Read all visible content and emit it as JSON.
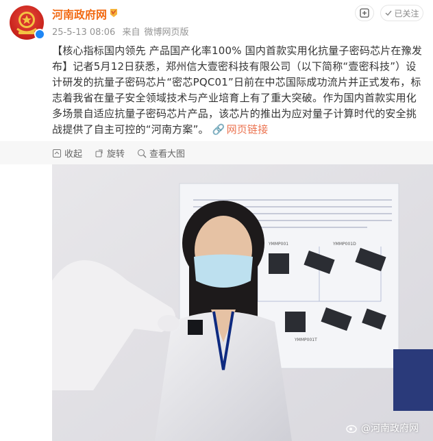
{
  "author": {
    "name": "河南政府网",
    "vip_icon": "vip-badge-icon",
    "verified_icon": "verified-icon"
  },
  "post_meta": {
    "time": "25-5-13 08:06",
    "source_prefix": "来自",
    "source": "微博网页版"
  },
  "actions": {
    "follow_label": "已关注",
    "plus_icon": "add-group-icon"
  },
  "post": {
    "text": "【核心指标国内领先 产品国产化率100% 国内首款实用化抗量子密码芯片在豫发布】记者5月12日获悉，郑州信大壹密科技有限公司（以下简称“壹密科技”）设计研发的抗量子密码芯片“密芯PQC01”日前在中芯国际成功流片并正式发布，标志着我省在量子安全领域技术与产业培育上有了重大突破。作为国内首款实用化多场景自适应抗量子密码芯片产品，该芯片的推出为应对量子计算时代的安全挑战提供了自主可控的“河南方案”。",
    "link_label": "网页链接",
    "link_icon": "link-icon"
  },
  "toolbar": {
    "collapse_label": "收起",
    "rotate_label": "旋转",
    "view_large_label": "查看大图"
  },
  "image": {
    "watermark": "@河南政府网",
    "board_caption_1": "YMMP001",
    "board_caption_2": "YMMP001D",
    "board_caption_3": "YMMP001T"
  },
  "colors": {
    "name": "#f26a13",
    "link": "#eb7350",
    "meta": "#939393",
    "toolbar_bg": "#f7f7f7"
  }
}
